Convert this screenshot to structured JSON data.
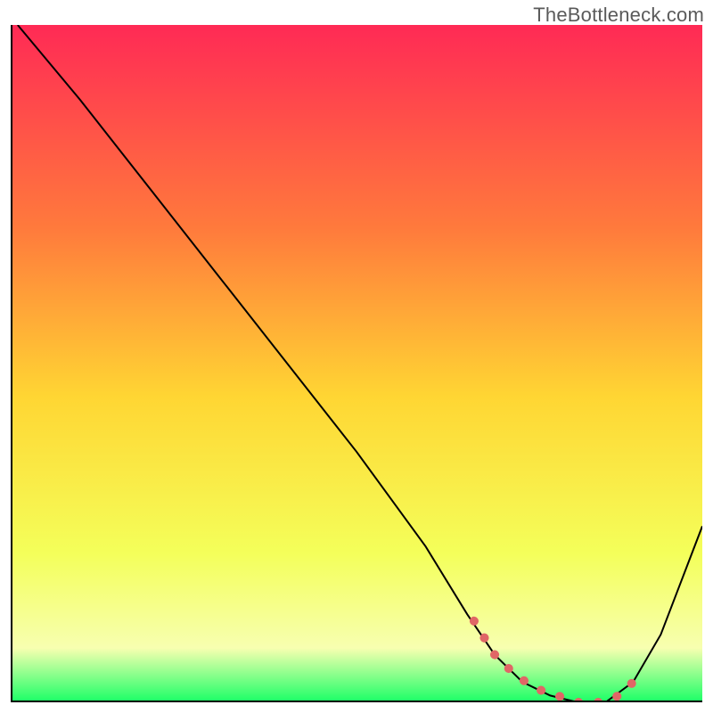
{
  "watermark": "TheBottleneck.com",
  "chart_data": {
    "type": "line",
    "title": "",
    "xlabel": "",
    "ylabel": "",
    "xlim": [
      0,
      100
    ],
    "ylim": [
      0,
      100
    ],
    "grid": false,
    "gradient_colors": {
      "top": "#ff2a55",
      "upper_mid": "#ff7a3c",
      "mid": "#ffd633",
      "lower_mid": "#f4ff5a",
      "pale": "#f7ffb0",
      "bottom": "#19ff66"
    },
    "series": [
      {
        "name": "bottleneck-curve",
        "stroke": "#000000",
        "stroke_width": 2,
        "x": [
          1,
          10,
          20,
          30,
          40,
          50,
          60,
          66,
          70,
          74,
          78,
          82,
          86,
          90,
          94,
          100
        ],
        "y": [
          100,
          89,
          76,
          63,
          50,
          37,
          23,
          13,
          7,
          3,
          1,
          0,
          0,
          3,
          10,
          26
        ]
      },
      {
        "name": "optimal-region-dots",
        "stroke": "#e06666",
        "stroke_width": 10,
        "linecap": "round",
        "x": [
          67,
          70,
          73,
          76,
          79,
          82,
          85,
          88,
          90
        ],
        "y": [
          12,
          7,
          4,
          2,
          1,
          0,
          0,
          1,
          3
        ]
      }
    ]
  }
}
